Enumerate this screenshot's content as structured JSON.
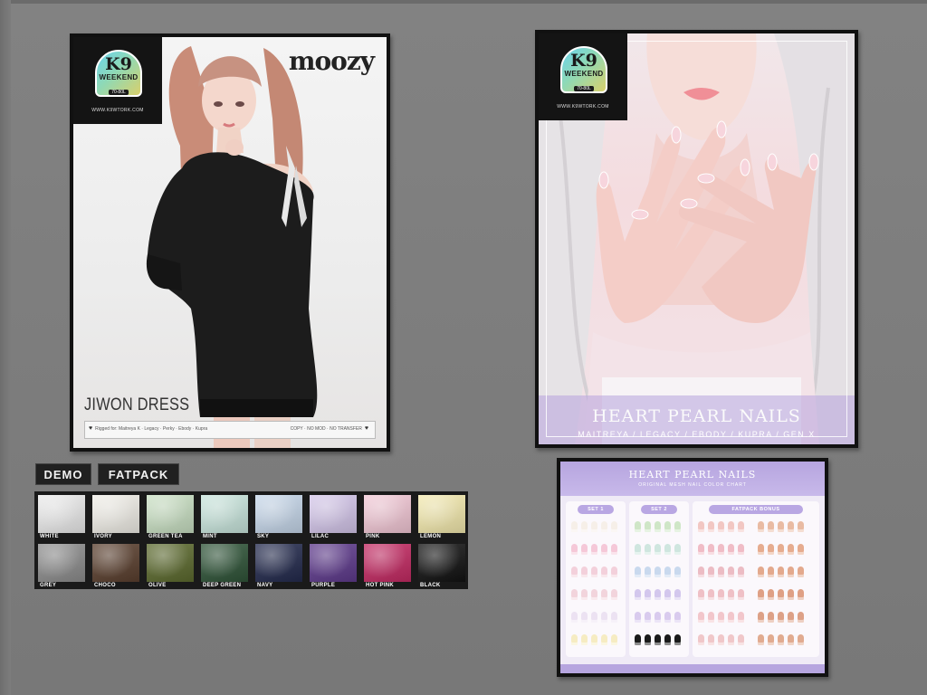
{
  "poster_left": {
    "badge": {
      "k9": "K9",
      "weekend": "WEEKEND",
      "sale": "70-80L",
      "url": "WWW.K9WTORK.COM"
    },
    "brand": "moozy",
    "title": "JIWON DRESS",
    "info_left": "Rigged for: Maitreya K · Legacy · Perky · Ebody · Kupra",
    "info_right": "COPY · NO MOD · NO TRANSFER"
  },
  "poster_right": {
    "badge": {
      "k9": "K9",
      "weekend": "WEEKEND",
      "sale": "70-80L",
      "url": "WWW.K9WTORK.COM"
    },
    "title": "HEART PEARL NAILS",
    "subtitle": "MAITREYA / LEGACY / EBODY / KUPRA / GEN.X"
  },
  "buttons": {
    "demo": "DEMO",
    "fatpack": "FATPACK"
  },
  "swatches": [
    {
      "name": "WHITE",
      "color": "#ececec"
    },
    {
      "name": "IVORY",
      "color": "#f1efe8"
    },
    {
      "name": "GREEN TEA",
      "color": "#c9e0c3"
    },
    {
      "name": "MINT",
      "color": "#c9e6dd"
    },
    {
      "name": "SKY",
      "color": "#c6d7ea"
    },
    {
      "name": "LILAC",
      "color": "#d4c6ea"
    },
    {
      "name": "PINK",
      "color": "#f3c8d6"
    },
    {
      "name": "LEMON",
      "color": "#f4eaae"
    },
    {
      "name": "GREY",
      "color": "#8d8d8d"
    },
    {
      "name": "CHOCO",
      "color": "#5a3f2e"
    },
    {
      "name": "OLIVE",
      "color": "#5c6a2e"
    },
    {
      "name": "DEEP GREEN",
      "color": "#2f5438"
    },
    {
      "name": "NAVY",
      "color": "#232a4d"
    },
    {
      "name": "PURPLE",
      "color": "#5e3a8c"
    },
    {
      "name": "HOT PINK",
      "color": "#c42a63"
    },
    {
      "name": "BLACK",
      "color": "#121212"
    }
  ],
  "color_chart": {
    "title": "HEART PEARL NAILS",
    "subtitle": "ORIGINAL MESH NAIL COLOR CHART",
    "sets": [
      "SET 1",
      "SET 2",
      "FATPACK BONUS"
    ],
    "row_colors_set1": [
      "#f6efe8",
      "#f5c8d8",
      "#f3d0db",
      "#f2d4dc",
      "#ece2f2",
      "#f6ecc2"
    ],
    "row_colors_set2": [
      "#cfe6c7",
      "#cfe6df",
      "#c9d9ee",
      "#d3c7ed",
      "#d9cbee",
      "#1a1a1a"
    ],
    "row_colors_bonus1": [
      "#f2c7c3",
      "#f0bcc6",
      "#ecbcc4",
      "#efc0c6",
      "#f2c6cb",
      "#f0c7c9"
    ],
    "row_colors_bonus2": [
      "#e9bba3",
      "#e6ac8f",
      "#e3a98d",
      "#dfa085",
      "#dda187",
      "#e1ab90"
    ]
  }
}
